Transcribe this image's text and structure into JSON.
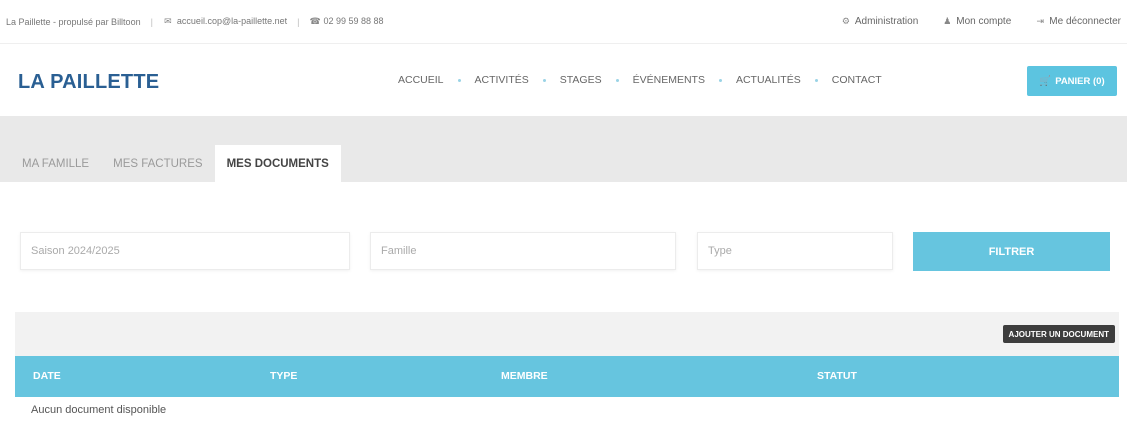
{
  "topbar": {
    "site_info": "La Paillette - propulsé par Billtoon",
    "email": "accueil.cop@la-paillette.net",
    "phone": "02 99 59 88 88",
    "links": [
      "Administration",
      "Mon compte",
      "Me déconnecter"
    ]
  },
  "header": {
    "logo": "LA PAILLETTE",
    "nav": [
      "ACCUEIL",
      "ACTIVITÉS",
      "STAGES",
      "ÉVÉNEMENTS",
      "ACTUALITÉS",
      "CONTACT"
    ],
    "cart": "PANIER (0)"
  },
  "tabs": [
    "MA FAMILLE",
    "MES FACTURES",
    "MES DOCUMENTS"
  ],
  "active_tab": "MES DOCUMENTS",
  "filters": {
    "saison": "Saison 2024/2025",
    "famille": "Famille",
    "type": "Type",
    "button": "FILTRER"
  },
  "documents": {
    "add_button": "AJOUTER UN DOCUMENT",
    "columns": [
      "DATE",
      "TYPE",
      "MEMBRE",
      "STATUT"
    ],
    "empty_message": "Aucun document disponible"
  },
  "colors": {
    "accent": "#5cc4e0",
    "logo": "#2a5f93",
    "band": "#e9e9e9"
  }
}
